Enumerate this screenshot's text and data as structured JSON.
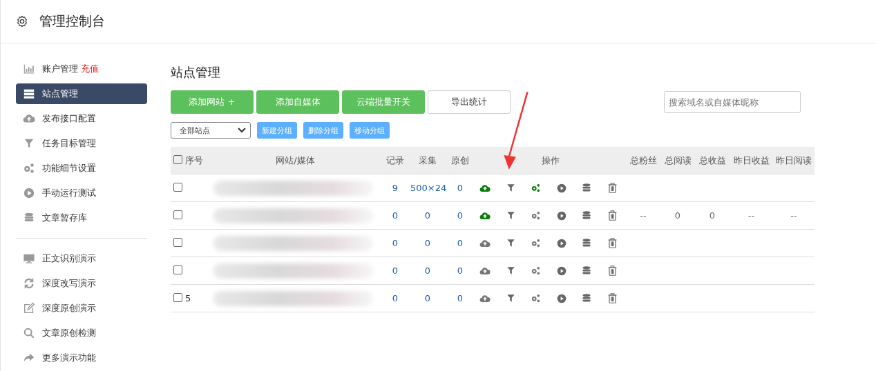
{
  "header": {
    "title": "管理控制台"
  },
  "sidebar": {
    "groups": [
      [
        {
          "label": "账户管理",
          "badge": "充值",
          "selected": false
        },
        {
          "label": "站点管理",
          "selected": true
        },
        {
          "label": "发布接口配置",
          "selected": false
        },
        {
          "label": "任务目标管理",
          "selected": false
        },
        {
          "label": "功能细节设置",
          "selected": false
        },
        {
          "label": "手动运行测试",
          "selected": false
        },
        {
          "label": "文章暂存库",
          "selected": false
        }
      ],
      [
        {
          "label": "正文识别演示",
          "selected": false
        },
        {
          "label": "深度改写演示",
          "selected": false
        },
        {
          "label": "深度原创演示",
          "selected": false
        },
        {
          "label": "文章原创检测",
          "selected": false
        },
        {
          "label": "更多演示功能",
          "selected": false
        }
      ]
    ]
  },
  "page_title": "站点管理",
  "actions": [
    {
      "label": "添加网站 +",
      "kind": "primary"
    },
    {
      "label": "添加自媒体",
      "kind": "primary"
    },
    {
      "label": "云端批量开关",
      "kind": "primary"
    },
    {
      "label": "导出统计",
      "kind": "outline"
    }
  ],
  "search": {
    "placeholder": "搜索域名或自媒体昵称"
  },
  "group_select": {
    "value": "全部站点"
  },
  "group_actions": [
    "新建分组",
    "删除分组",
    "移动分组"
  ],
  "table": {
    "select_all_checked": false,
    "columns": [
      "序号",
      "网站/媒体",
      "记录",
      "采集",
      "原创",
      "操作",
      "总粉丝",
      "总阅读",
      "总收益",
      "昨日收益",
      "昨日阅读"
    ],
    "rows": [
      {
        "index": "",
        "checked": false,
        "records": "9",
        "collected": "500×24",
        "original": "0",
        "publish_on": true,
        "settings_on": true,
        "stats": []
      },
      {
        "index": "",
        "checked": false,
        "records": "0",
        "collected": "0",
        "original": "0",
        "publish_on": true,
        "settings_on": false,
        "stats": [
          "--",
          "0",
          "0",
          "--",
          "--"
        ]
      },
      {
        "index": "",
        "checked": false,
        "records": "0",
        "collected": "0",
        "original": "0",
        "publish_on": false,
        "settings_on": false,
        "stats": []
      },
      {
        "index": "",
        "checked": false,
        "records": "0",
        "collected": "0",
        "original": "0",
        "publish_on": false,
        "settings_on": false,
        "stats": []
      },
      {
        "index": "5",
        "checked": false,
        "records": "0",
        "collected": "0",
        "original": "0",
        "publish_on": false,
        "settings_on": false,
        "stats": []
      }
    ]
  }
}
